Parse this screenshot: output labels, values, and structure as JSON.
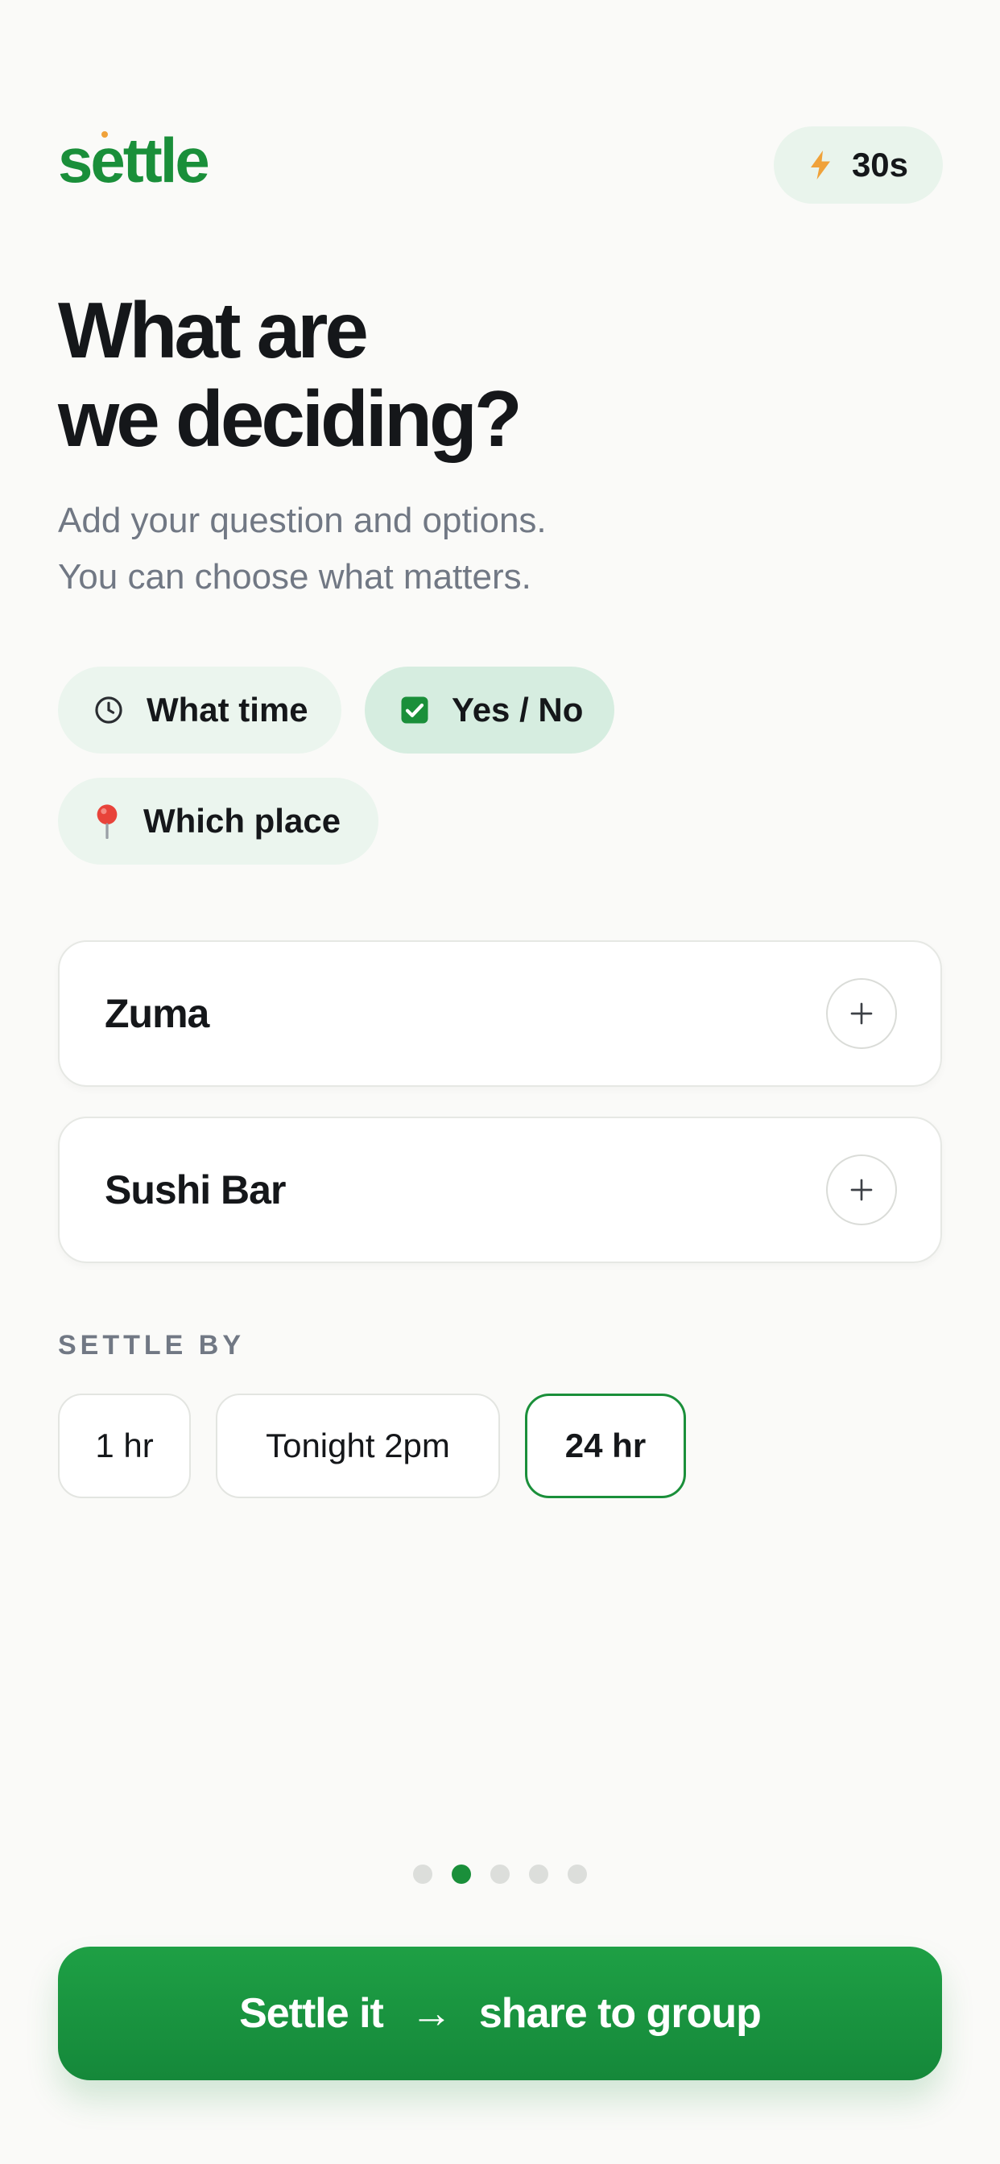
{
  "header": {
    "logo": "settle",
    "timer": {
      "icon": "lightning-icon",
      "label": "30s"
    }
  },
  "title": {
    "line1": "What are",
    "line2": "we deciding?"
  },
  "subtitle": {
    "line1": "Add your question and options.",
    "line2": "You can choose what matters."
  },
  "question_types": [
    {
      "label": "What time",
      "icon": "clock-icon",
      "selected": false
    },
    {
      "label": "Yes / No",
      "icon": "checkbox-icon",
      "selected": true
    },
    {
      "label": "Which place",
      "icon": "pin-icon",
      "selected": false
    }
  ],
  "options": [
    {
      "label": "Zuma"
    },
    {
      "label": "Sushi Bar"
    }
  ],
  "settle_by": {
    "label": "SETTLE BY",
    "choices": [
      {
        "label": "1 hr",
        "selected": false
      },
      {
        "label": "Tonight 2pm",
        "selected": false
      },
      {
        "label": "24 hr",
        "selected": true
      }
    ]
  },
  "pagination": {
    "count": 5,
    "active": 2
  },
  "cta": {
    "part1": "Settle it",
    "arrow": "→",
    "part2": "share to group"
  },
  "colors": {
    "brand_green": "#1a8f3a",
    "chip_bg": "#ebf5ee",
    "chip_selected_bg": "#d6ede0",
    "accent_orange": "#f0a23a",
    "muted_text": "#717884"
  }
}
